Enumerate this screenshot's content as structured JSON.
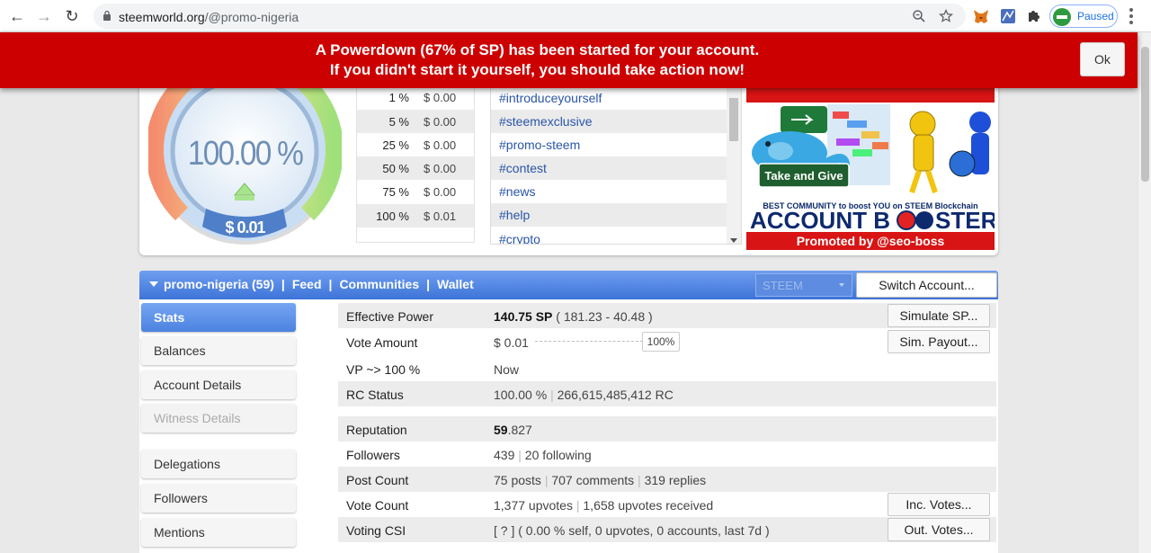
{
  "browser": {
    "url_domain": "steemworld.org",
    "url_path": "/@promo-nigeria",
    "profile_label": "Paused"
  },
  "alert": {
    "line1": "A Powerdown (67% of SP) has been started for your account.",
    "line2": "If you didn't start it yourself, you should take action now!",
    "ok_label": "Ok"
  },
  "gauge": {
    "percent": "100.00 %",
    "value": "$ 0.01",
    "level": 1.0
  },
  "vote_values": [
    {
      "pct": "1 %",
      "usd": "$ 0.00"
    },
    {
      "pct": "5 %",
      "usd": "$ 0.00"
    },
    {
      "pct": "25 %",
      "usd": "$ 0.00"
    },
    {
      "pct": "50 %",
      "usd": "$ 0.00"
    },
    {
      "pct": "75 %",
      "usd": "$ 0.00"
    },
    {
      "pct": "100 %",
      "usd": "$ 0.01"
    }
  ],
  "tags": [
    "#introduceyourself",
    "#steemexclusive",
    "#promo-steem",
    "#contest",
    "#news",
    "#help",
    "#crypto"
  ],
  "ad": {
    "take_give": "Take and Give",
    "tagline": "BEST COMMUNITY to boost YOU on STEEM Blockchain",
    "headline_a": "ACCOUNT B",
    "headline_b": "STER",
    "promoted": "Promoted by @seo-boss"
  },
  "account_bar": {
    "account": "promo-nigeria (59)",
    "links": [
      "Feed",
      "Communities",
      "Wallet"
    ],
    "separator": "|",
    "currency": "STEEM",
    "switch_label": "Switch Account..."
  },
  "sidebar": [
    "Stats",
    "Balances",
    "Account Details",
    "Witness Details",
    "Delegations",
    "Followers",
    "Mentions"
  ],
  "stats": {
    "effective_power": {
      "label": "Effective Power",
      "value_bold": "140.75 SP",
      "value_rest": " ( 181.23 - 40.48 )",
      "button": "Simulate SP..."
    },
    "vote_amount": {
      "label": "Vote Amount",
      "value": "$ 0.01",
      "slider_pct": "100%",
      "button": "Sim. Payout..."
    },
    "vp": {
      "label": "VP ~> 100 %",
      "value": "Now"
    },
    "rc": {
      "label": "RC Status",
      "pct": "100.00 %",
      "rc": "266,615,485,412 RC"
    },
    "reputation": {
      "label": "Reputation",
      "int": "59",
      "dec": ".827"
    },
    "followers": {
      "label": "Followers",
      "followers": "439",
      "following": "20 following"
    },
    "posts": {
      "label": "Post Count",
      "posts": "75 posts",
      "comments": "707 comments",
      "replies": "319 replies"
    },
    "votes": {
      "label": "Vote Count",
      "up": "1,377 upvotes",
      "received": "1,658 upvotes received",
      "button": "Inc. Votes..."
    },
    "csi": {
      "label": "Voting CSI",
      "value": "[ ? ] ( 0.00 % self, 0 upvotes, 0 accounts, last 7d )",
      "button": "Out. Votes..."
    }
  },
  "colors": {
    "alert": "#cc0000",
    "accent_blue": "#4a80e0",
    "link_blue": "#2a55a8"
  }
}
